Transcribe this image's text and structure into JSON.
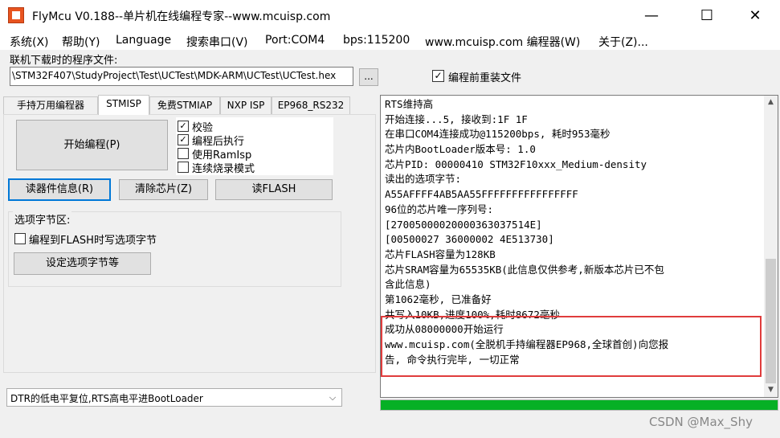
{
  "window": {
    "title": "FlyMcu V0.188--单片机在线编程专家--www.mcuisp.com",
    "minimize": "—",
    "maximize": "☐",
    "close": "✕"
  },
  "menu": {
    "items": [
      "系统(X)",
      "帮助(Y)",
      "Language",
      "搜索串口(V)",
      "Port:COM4",
      "bps:115200",
      "www.mcuisp.com 编程器(W)",
      "关于(Z)..."
    ]
  },
  "file": {
    "label": "联机下载时的程序文件:",
    "path": "\\STM32F407\\StudyProject\\Test\\UCTest\\MDK-ARM\\UCTest\\UCTest.hex",
    "browse": "...",
    "reload_label": "编程前重装文件",
    "reload_checked": "✓"
  },
  "tabs": [
    "手持万用编程器",
    "STMISP",
    "免费STMIAP",
    "NXP ISP",
    "EP968_RS232"
  ],
  "stmisp": {
    "start_button": "开始编程(P)",
    "options": [
      {
        "label": "校验",
        "checked": "✓"
      },
      {
        "label": "编程后执行",
        "checked": "✓"
      },
      {
        "label": "使用RamIsp",
        "checked": ""
      },
      {
        "label": "连续烧录模式",
        "checked": ""
      }
    ],
    "read_info_button": "读器件信息(R)",
    "clear_chip_button": "清除芯片(Z)",
    "read_flash_button": "读FLASH",
    "option_group_title": "选项字节区:",
    "option_write_label": "编程到FLASH时写选项字节",
    "option_write_checked": "",
    "option_set_button": "设定选项字节等"
  },
  "dtr": {
    "selected": "DTR的低电平复位,RTS高电平进BootLoader",
    "arrow": "⌵"
  },
  "log": {
    "lines": [
      "RTS维持高",
      "开始连接...5, 接收到:1F 1F",
      "在串口COM4连接成功@115200bps, 耗时953毫秒",
      "芯片内BootLoader版本号: 1.0",
      "芯片PID: 00000410  STM32F10xxx_Medium-density",
      "读出的选项字节:",
      "A55AFFFF4AB5AA55FFFFFFFFFFFFFFFF",
      "96位的芯片唯一序列号:",
      "[27005000020000363037514E]",
      "[00500027 36000002 4E513730]",
      "芯片FLASH容量为128KB",
      "芯片SRAM容量为65535KB(此信息仅供参考,新版本芯片已不包",
      "含此信息)",
      "第1062毫秒, 已准备好",
      "共写入10KB,进度100%,耗时8672毫秒",
      "成功从08000000开始运行",
      "www.mcuisp.com(全脱机手持编程器EP968,全球首创)向您报",
      "告, 命令执行完毕, 一切正常"
    ],
    "scroll_up": "▲",
    "scroll_down": "▼"
  },
  "progress": {
    "value": 1.0,
    "color": "#06b025"
  },
  "colors": {
    "highlight": "#e03c3c",
    "focus": "#0078d7"
  },
  "watermark": "CSDN @Max_Shy"
}
